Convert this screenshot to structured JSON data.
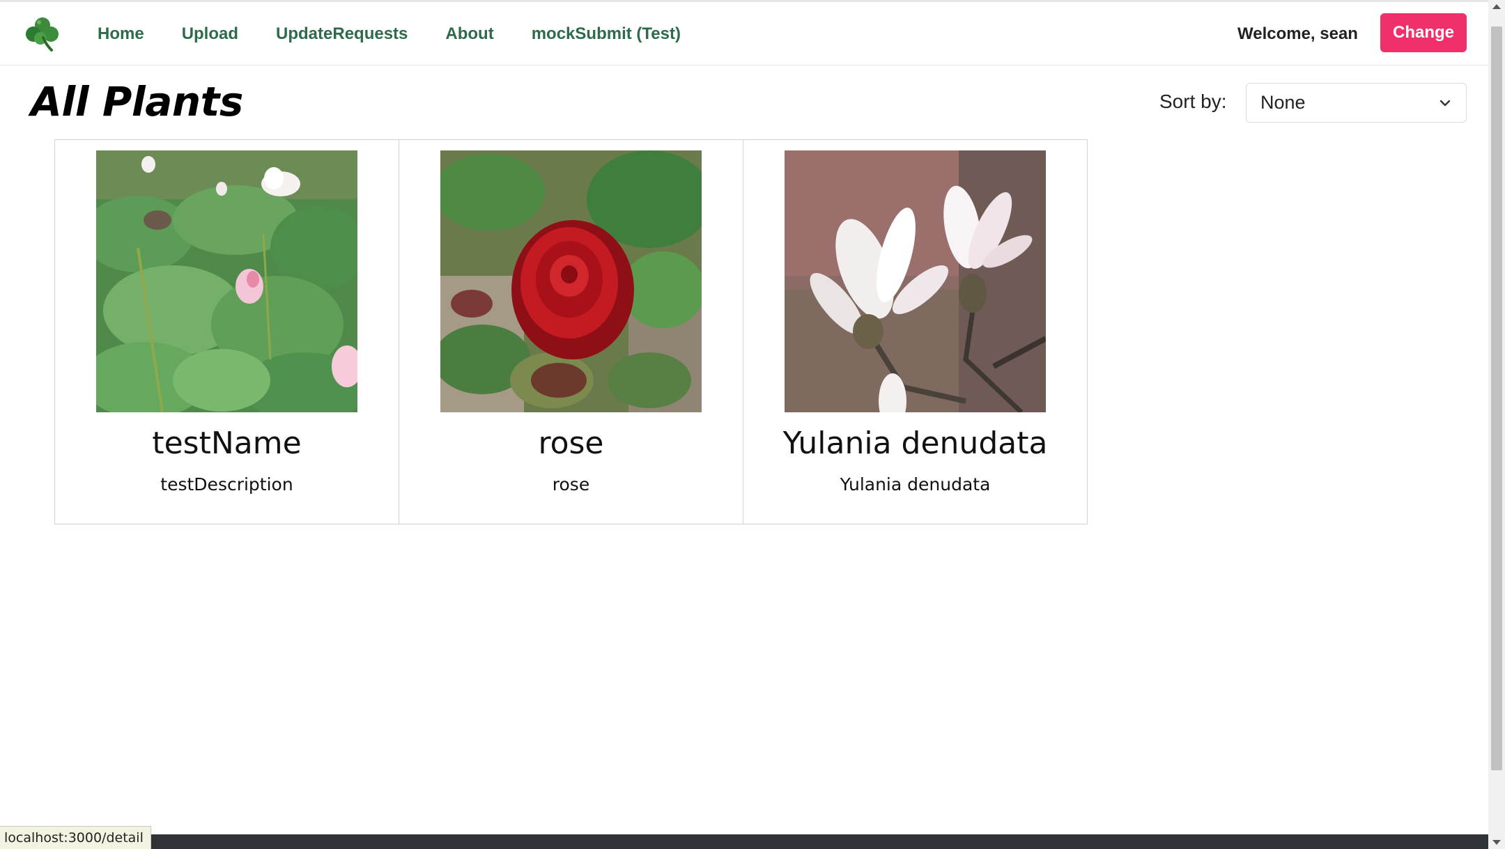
{
  "navbar": {
    "logo_icon": "clover-icon",
    "links": [
      "Home",
      "Upload",
      "UpdateRequests",
      "About",
      "mockSubmit (Test)"
    ],
    "welcome": "Welcome, sean",
    "change_label": "Change",
    "accent_color": "#f0306a",
    "link_color": "#2f6b4a"
  },
  "main": {
    "title": "All Plants",
    "sort_label": "Sort by:",
    "sort_value": "None"
  },
  "plants": [
    {
      "name": "testName",
      "description": "testDescription",
      "image": "lotus-photo"
    },
    {
      "name": "rose",
      "description": "rose",
      "image": "red-rose-photo"
    },
    {
      "name": "Yulania denudata",
      "description": "Yulania denudata",
      "image": "white-magnolia-photo"
    }
  ],
  "status_bar": {
    "url": "localhost:3000/detail"
  }
}
